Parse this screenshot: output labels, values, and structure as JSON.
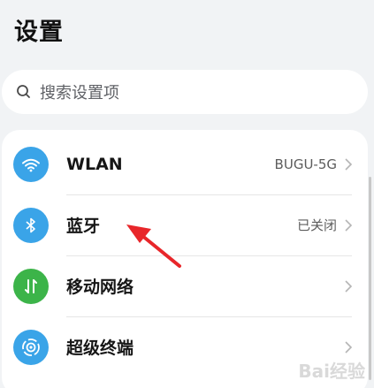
{
  "header": {
    "title": "设置"
  },
  "search": {
    "placeholder": "搜索设置项"
  },
  "settings": [
    {
      "id": "wlan",
      "label": "WLAN",
      "value": "BUGU-5G",
      "icon": "wifi-icon",
      "color": "#3aa4e8"
    },
    {
      "id": "bluetooth",
      "label": "蓝牙",
      "value": "已关闭",
      "icon": "bluetooth-icon",
      "color": "#3aa4e8"
    },
    {
      "id": "mobile-network",
      "label": "移动网络",
      "value": "",
      "icon": "mobile-data-icon",
      "color": "#3cb449"
    },
    {
      "id": "super-device",
      "label": "超级终端",
      "value": "",
      "icon": "super-device-icon",
      "color": "#3aa4e8"
    }
  ],
  "colors": {
    "annotation_arrow": "#e8262a"
  },
  "watermark": {
    "text": "Bai经验"
  }
}
